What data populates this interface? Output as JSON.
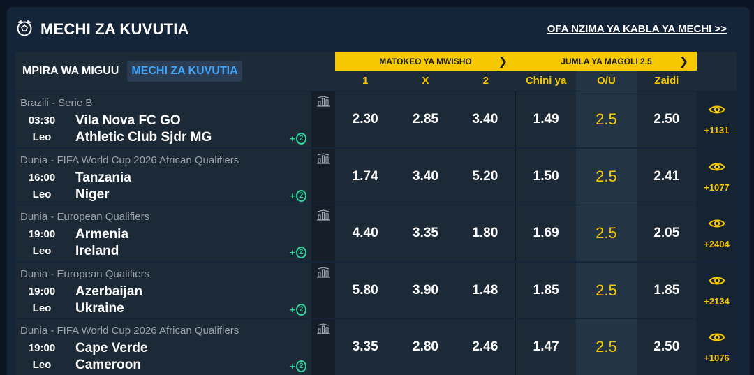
{
  "header": {
    "title": "MECHI ZA KUVUTIA",
    "link": "OFA NZIMA YA KABLA YA MECHI >>"
  },
  "tabs": {
    "sport": "MPIRA WA MIGUU",
    "live": "MECHI ZA KUVUTIA"
  },
  "markets": {
    "result": "MATOKEO YA MWISHO",
    "totals": "JUMLA YA MAGOLI 2.5"
  },
  "columns": [
    "1",
    "X",
    "2",
    "Chini ya",
    "O/U",
    "Zaidi"
  ],
  "colors": {
    "accent": "#f6c800",
    "live_tab": "#3ea8ff",
    "plus": "#2ed29a"
  },
  "matches": [
    {
      "league": "Brazili - Serie B",
      "time": "03:30",
      "day": "Leo",
      "team1": "Vila Nova FC GO",
      "team2": "Athletic Club Sjdr MG",
      "plus": "+2",
      "odds": [
        "2.30",
        "2.85",
        "3.40",
        "1.49",
        "2.5",
        "2.50"
      ],
      "more": "+1131"
    },
    {
      "league": "Dunia - FIFA World Cup 2026 African Qualifiers",
      "time": "16:00",
      "day": "Leo",
      "team1": "Tanzania",
      "team2": "Niger",
      "plus": "+2",
      "odds": [
        "1.74",
        "3.40",
        "5.20",
        "1.50",
        "2.5",
        "2.41"
      ],
      "more": "+1077"
    },
    {
      "league": "Dunia - European Qualifiers",
      "time": "19:00",
      "day": "Leo",
      "team1": "Armenia",
      "team2": "Ireland",
      "plus": "+2",
      "odds": [
        "4.40",
        "3.35",
        "1.80",
        "1.69",
        "2.5",
        "2.05"
      ],
      "more": "+2404"
    },
    {
      "league": "Dunia - European Qualifiers",
      "time": "19:00",
      "day": "Leo",
      "team1": "Azerbaijan",
      "team2": "Ukraine",
      "plus": "+2",
      "odds": [
        "5.80",
        "3.90",
        "1.48",
        "1.85",
        "2.5",
        "1.85"
      ],
      "more": "+2134"
    },
    {
      "league": "Dunia - FIFA World Cup 2026 African Qualifiers",
      "time": "19:00",
      "day": "Leo",
      "team1": "Cape Verde",
      "team2": "Cameroon",
      "plus": "+2",
      "odds": [
        "3.35",
        "2.80",
        "2.46",
        "1.47",
        "2.5",
        "2.50"
      ],
      "more": "+1076"
    }
  ]
}
